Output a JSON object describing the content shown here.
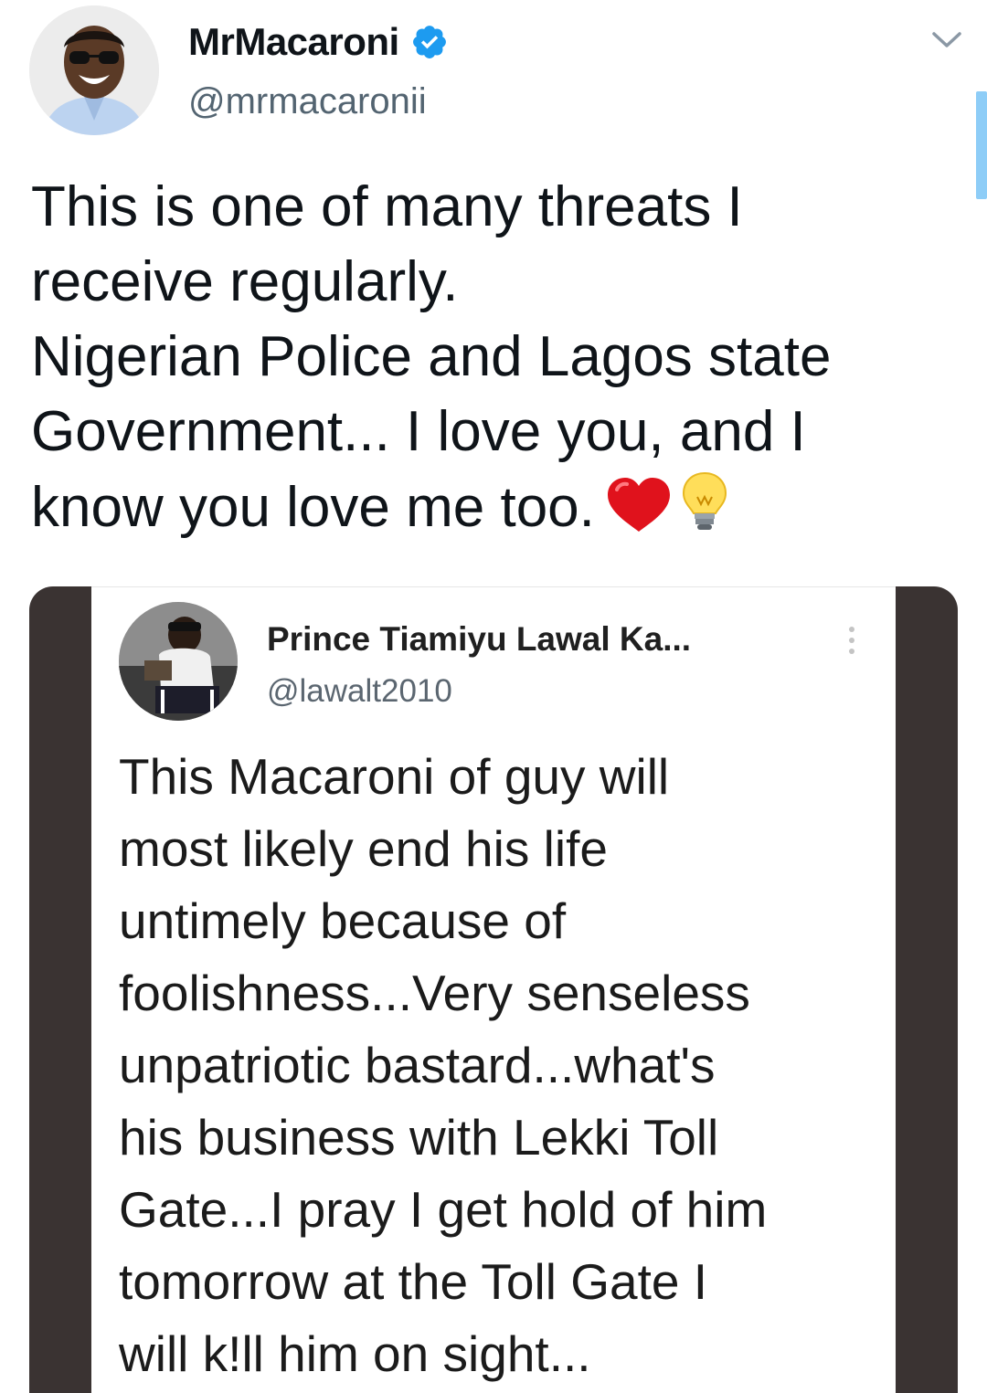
{
  "tweet": {
    "author": {
      "display_name": "MrMacaroni",
      "handle": "@mrmacaronii",
      "verified": true
    },
    "text_lines": [
      "This is one of many threats I",
      "receive regularly.",
      "Nigerian Police and Lagos state",
      "Government... I love you, and I",
      "know you love me too."
    ],
    "emojis": [
      "heart-emoji",
      "light-bulb-emoji"
    ]
  },
  "quoted_screenshot": {
    "author": {
      "display_name": "Prince Tiamiyu Lawal Ka...",
      "handle": "@lawalt2010"
    },
    "text_lines": [
      "This Macaroni of guy will",
      "most likely end his life",
      "untimely because of",
      "foolishness...Very senseless",
      "unpatriotic bastard...what's",
      "his business with Lekki Toll",
      "Gate...I pray I get hold of him",
      "tomorrow at the Toll Gate I",
      "will k!ll him on sight..."
    ]
  },
  "icons": [
    "verified-badge-icon",
    "chevron-down-icon",
    "more-options-icon"
  ],
  "colors": {
    "verified_blue": "#1d9bf0",
    "handle_gray": "#536471",
    "media_frame": "#3a3332",
    "scroll_indicator": "#8ecdf7"
  }
}
